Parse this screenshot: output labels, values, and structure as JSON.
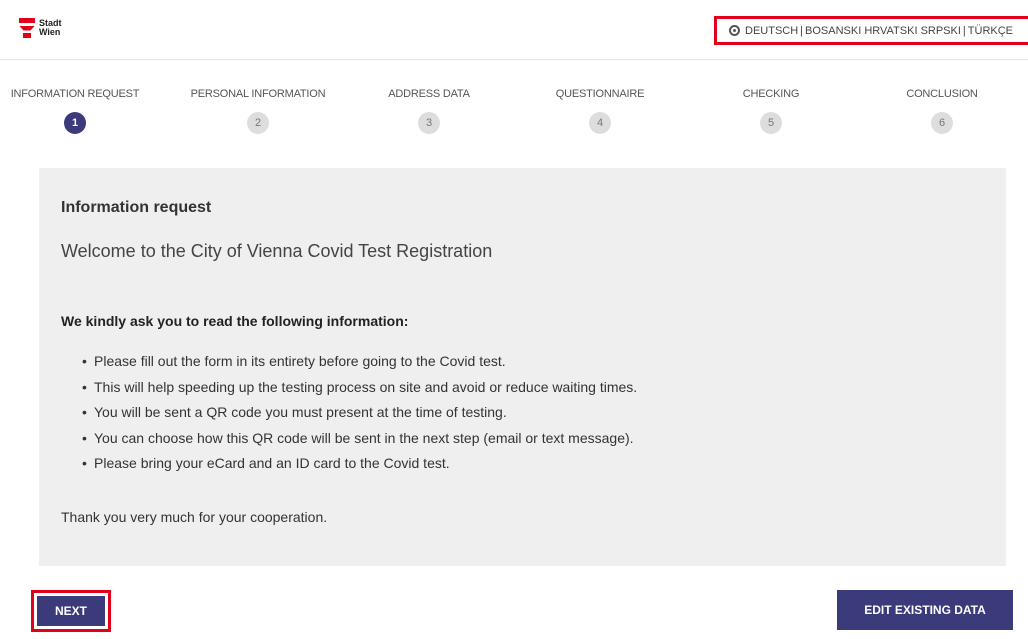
{
  "header": {
    "logo_line1": "Stadt",
    "logo_line2": "Wien",
    "languages": [
      "DEUTSCH",
      "BOSANSKI HRVATSKI SRPSKI",
      "TÜRKÇE"
    ],
    "accent_color": "#e2001a"
  },
  "stepper": {
    "steps": [
      {
        "label": "INFORMATION REQUEST",
        "number": "1",
        "active": true
      },
      {
        "label": "PERSONAL INFORMATION",
        "number": "2",
        "active": false
      },
      {
        "label": "ADDRESS DATA",
        "number": "3",
        "active": false
      },
      {
        "label": "QUESTIONNAIRE",
        "number": "4",
        "active": false
      },
      {
        "label": "CHECKING",
        "number": "5",
        "active": false
      },
      {
        "label": "CONCLUSION",
        "number": "6",
        "active": false
      }
    ],
    "active_color": "#3b3a7a"
  },
  "content": {
    "title": "Information request",
    "welcome": "Welcome to the City of Vienna Covid Test Registration",
    "intro": "We kindly ask you to read the following information:",
    "items": [
      "Please fill out the form in its entirety before going to the Covid test.",
      "This will help speeding up the testing process on site and avoid or reduce waiting times.",
      "You will be sent a QR code you must present at the time of testing.",
      "You can choose how this QR code will be sent in the next step (email or text message).",
      "Please bring your eCard and an ID card to the Covid test."
    ],
    "thanks": "Thank you very much for your cooperation."
  },
  "actions": {
    "next_label": "NEXT",
    "edit_label": "EDIT EXISTING DATA"
  }
}
